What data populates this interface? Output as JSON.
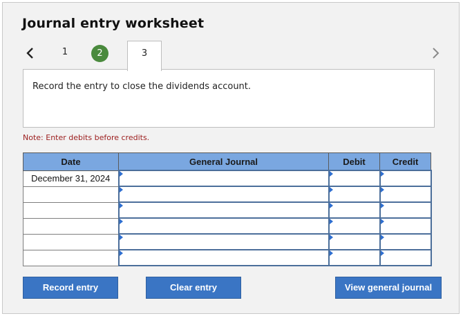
{
  "header": {
    "title": "Journal entry worksheet"
  },
  "nav": {
    "steps": [
      {
        "label": "1"
      },
      {
        "label": "2"
      },
      {
        "label": "3"
      }
    ],
    "completed_color": "#4a8a3d"
  },
  "panel": {
    "instruction": "Record the entry to close the dividends account."
  },
  "note": "Note: Enter debits before credits.",
  "table": {
    "headers": {
      "date": "Date",
      "general_journal": "General Journal",
      "debit": "Debit",
      "credit": "Credit"
    },
    "rows": [
      {
        "date": "December 31, 2024",
        "account": "",
        "debit": "",
        "credit": ""
      },
      {
        "date": "",
        "account": "",
        "debit": "",
        "credit": ""
      },
      {
        "date": "",
        "account": "",
        "debit": "",
        "credit": ""
      },
      {
        "date": "",
        "account": "",
        "debit": "",
        "credit": ""
      },
      {
        "date": "",
        "account": "",
        "debit": "",
        "credit": ""
      },
      {
        "date": "",
        "account": "",
        "debit": "",
        "credit": ""
      }
    ],
    "header_color": "#7aa7e0"
  },
  "buttons": {
    "record": "Record entry",
    "clear": "Clear entry",
    "view": "View general journal",
    "color": "#3a75c4"
  },
  "icons": {
    "prev": "chevron-left-icon",
    "next": "chevron-right-icon",
    "cell_marker": "triangle-right-icon"
  }
}
